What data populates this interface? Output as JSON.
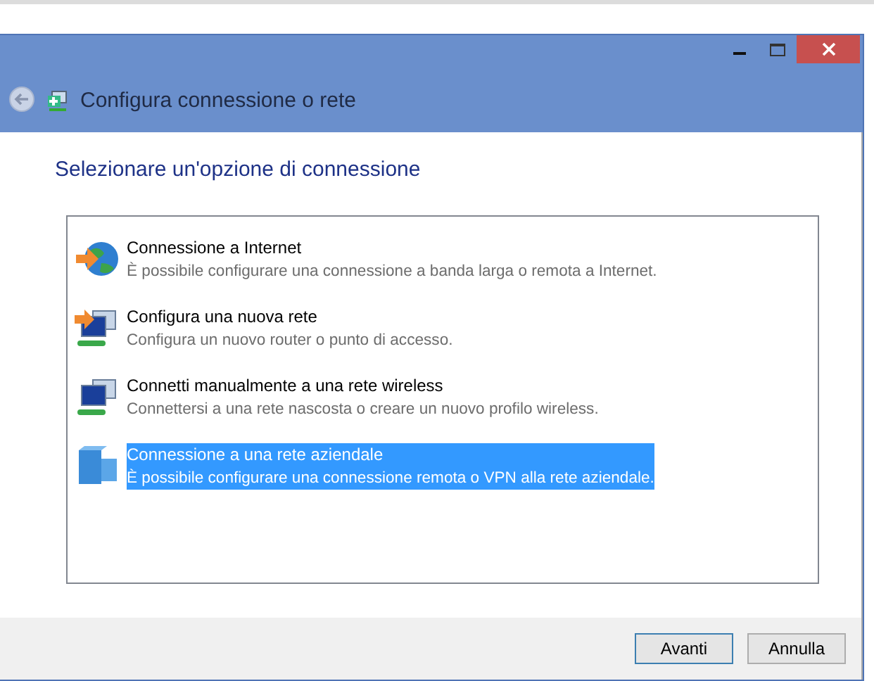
{
  "window": {
    "title": "Configura connessione o rete"
  },
  "heading": "Selezionare un'opzione di connessione",
  "options": [
    {
      "title": "Connessione a Internet",
      "description": "È possibile configurare una connessione a banda larga o remota a Internet.",
      "selected": false
    },
    {
      "title": "Configura una nuova rete",
      "description": "Configura un nuovo router o punto di accesso.",
      "selected": false
    },
    {
      "title": "Connetti manualmente a una rete wireless",
      "description": "Connettersi a una rete nascosta o creare un nuovo profilo wireless.",
      "selected": false
    },
    {
      "title": "Connessione a una rete aziendale",
      "description": "È possibile configurare una connessione remota o VPN alla rete aziendale.",
      "selected": true
    }
  ],
  "buttons": [
    {
      "label": "Avanti",
      "default": true
    },
    {
      "label": "Annulla",
      "default": false
    }
  ]
}
